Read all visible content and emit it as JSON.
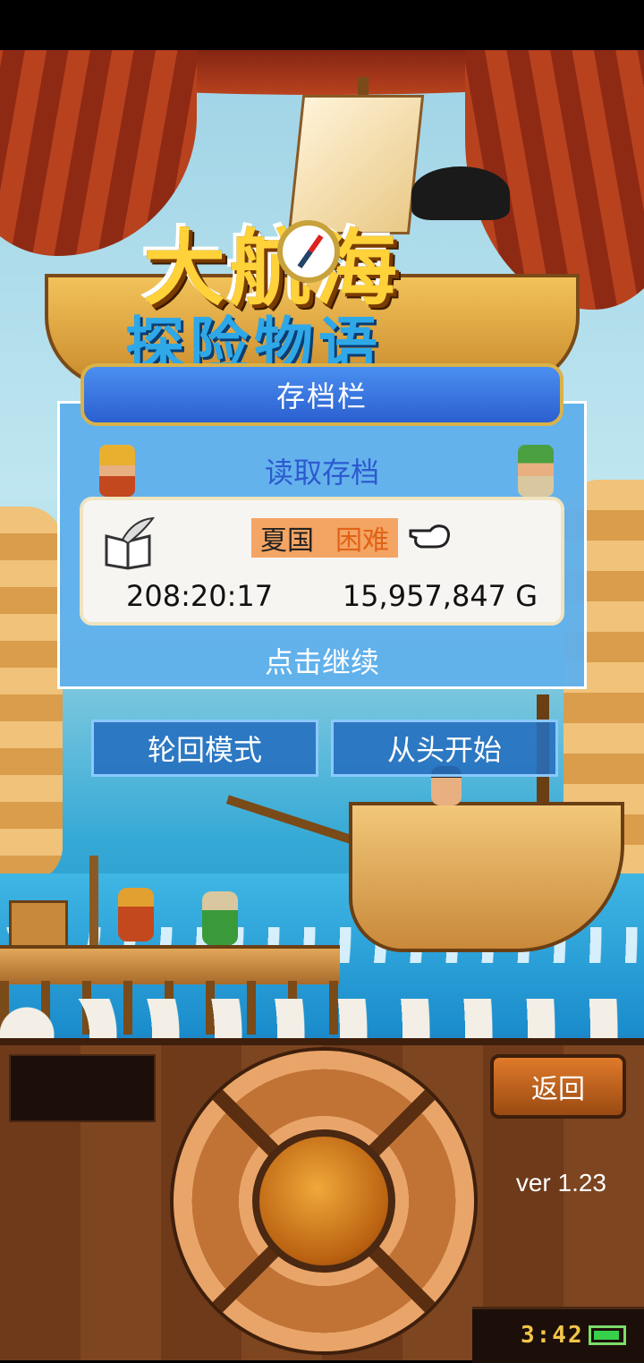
{
  "game": {
    "logo_main": "大航海",
    "logo_sub": "探险物语"
  },
  "save_panel": {
    "title": "存档栏",
    "load_label": "读取存档",
    "slot": {
      "nation": "夏国",
      "difficulty": "困难",
      "play_time": "208:20:17",
      "gold": "15,957,847 G"
    },
    "continue_label": "点击继续"
  },
  "buttons": {
    "cycle_mode": "轮回模式",
    "new_game": "从头开始",
    "back": "返回"
  },
  "footer": {
    "version": "ver 1.23",
    "clock": "3:42"
  },
  "colors": {
    "panel_blue": "#60b0eb",
    "title_bar": "#2b5fd0",
    "difficulty_orange": "#e06316",
    "wood": "#6e3a1a"
  }
}
